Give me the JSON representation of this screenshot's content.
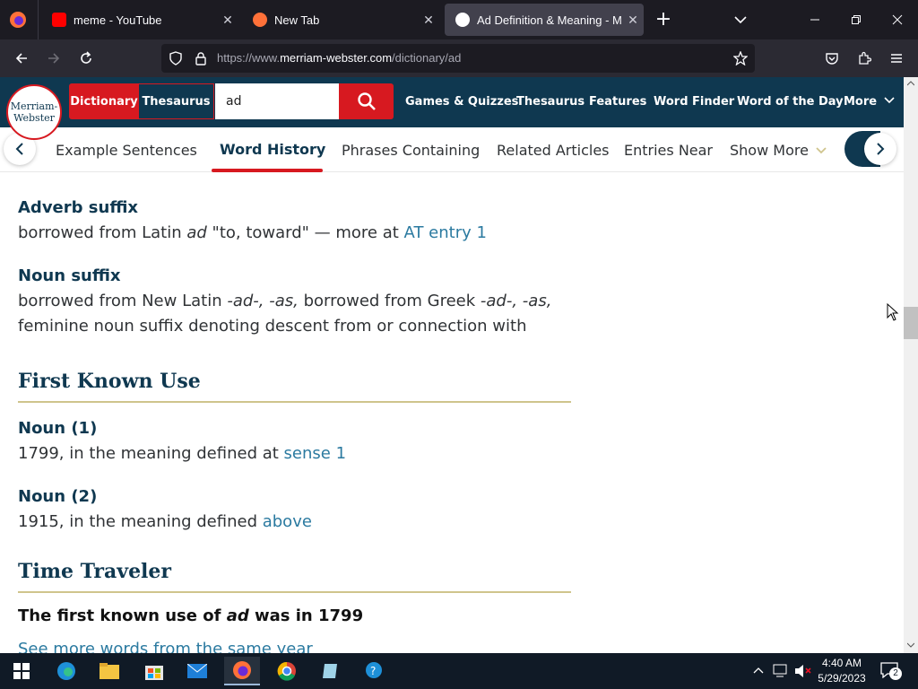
{
  "browser": {
    "tabs": [
      {
        "title": "meme - YouTube",
        "favicon_color": "#ff0000"
      },
      {
        "title": "New Tab",
        "favicon_color": "#ff7139"
      },
      {
        "title": "Ad Definition & Meaning - Merriam-Webster",
        "favicon_color": "#ffffff"
      }
    ],
    "url_prefix": "https://www.",
    "url_domain": "merriam-webster.com",
    "url_path": "/dictionary/ad"
  },
  "site": {
    "logo_line1": "Merriam-",
    "logo_line2": "Webster",
    "dictionary_tab": "Dictionary",
    "thesaurus_tab": "Thesaurus",
    "search_value": "ad",
    "nav": [
      "Games & Quizzes",
      "Thesaurus",
      "Features",
      "Word Finder",
      "Word of the Day",
      "More"
    ]
  },
  "subnav": {
    "items": [
      "Example Sentences",
      "Word History",
      "Phrases Containing",
      "Related Articles",
      "Entries Near",
      "Show More"
    ],
    "active": "Word History"
  },
  "content": {
    "adverb_heading": "Adverb suffix",
    "adverb_text_1": "borrowed from Latin ",
    "adverb_italic": "ad",
    "adverb_text_2": " \"to, toward\" — more at ",
    "adverb_link": "AT entry 1",
    "noun_heading": "Noun suffix",
    "noun_line1_a": "borrowed from New Latin ",
    "noun_line1_i1": "-ad-, -as,",
    "noun_line1_b": " borrowed from Greek ",
    "noun_line1_i2": "-ad-, -as,",
    "noun_line2": "feminine noun suffix denoting descent from or connection with",
    "first_known_use": "First Known Use",
    "noun1_heading": "Noun (1)",
    "noun1_text": "1799, in the meaning defined at ",
    "noun1_link": "sense 1",
    "noun2_heading": "Noun (2)",
    "noun2_text": "1915, in the meaning defined ",
    "noun2_link": "above",
    "time_traveler": "Time Traveler",
    "tt_text_a": "The first known use of ",
    "tt_text_i": "ad",
    "tt_text_b": " was in 1799",
    "tt_link": "See more words from the same year"
  },
  "taskbar": {
    "time": "4:40 AM",
    "date": "5/29/2023",
    "notification_count": "2"
  }
}
